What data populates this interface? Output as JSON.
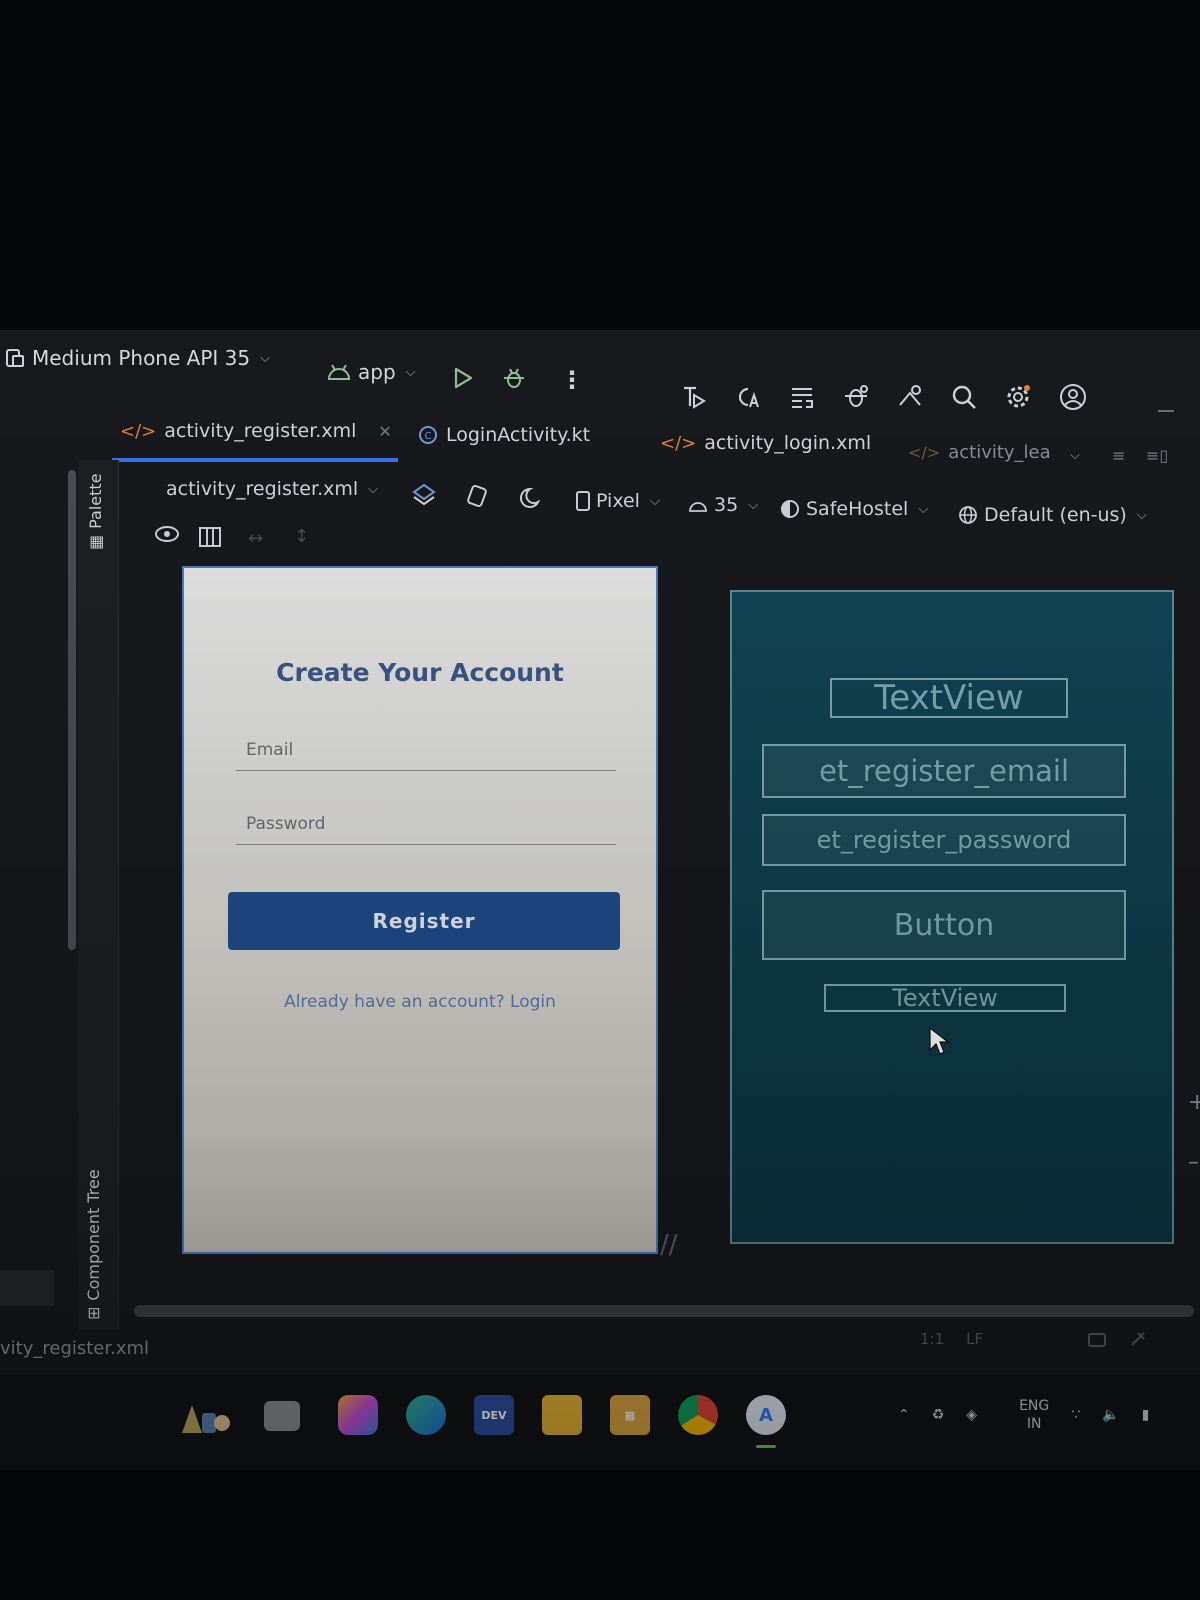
{
  "toolbar": {
    "device": "Medium Phone API 35",
    "module": "app"
  },
  "tabs": [
    {
      "label": "activity_register.xml"
    },
    {
      "label": "LoginActivity.kt"
    },
    {
      "label": "activity_login.xml"
    },
    {
      "label": "activity_lea"
    }
  ],
  "side": {
    "palette": "Palette",
    "component_tree": "Component Tree"
  },
  "design_toolbar": {
    "file": "activity_register.xml",
    "device": "Pixel",
    "api": "35",
    "theme": "SafeHostel",
    "locale": "Default (en-us)"
  },
  "design": {
    "title": "Create Your Account",
    "email_hint": "Email",
    "password_hint": "Password",
    "register_button": "Register",
    "login_link": "Already have an account? Login"
  },
  "blueprint": {
    "title": "TextView",
    "email": "et_register_email",
    "password": "et_register_password",
    "button": "Button",
    "link": "TextView"
  },
  "status": {
    "file": "vity_register.xml",
    "position": "1:1",
    "line_ending": "LF"
  },
  "tray": {
    "lang": "ENG",
    "region": "IN"
  },
  "colors": {
    "accent": "#3574f0",
    "register_button": "#1f4d8c",
    "blueprint": "#114655"
  }
}
